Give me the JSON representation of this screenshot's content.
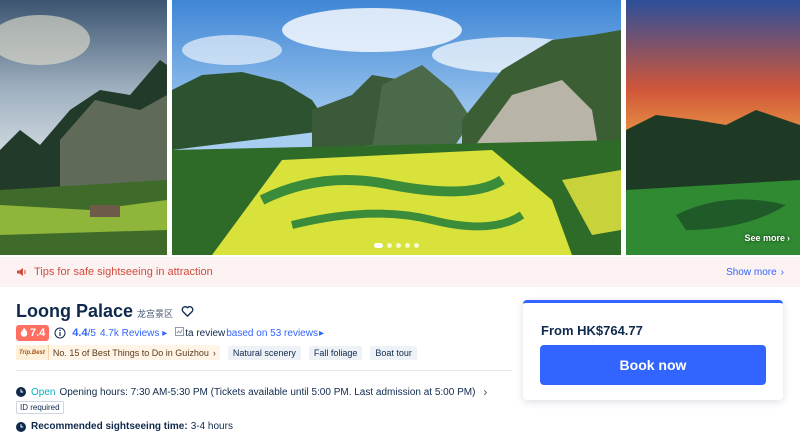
{
  "gallery": {
    "see_more_label": "See more",
    "dot_count": 5,
    "active_dot": 1
  },
  "tips": {
    "text": "Tips for safe sightseeing in attraction",
    "show_more": "Show more"
  },
  "attraction": {
    "name": "Loong Palace",
    "name_local": "龙宫景区",
    "hot_score": "7.4",
    "rating": "4.4",
    "rating_max": "/5",
    "reviews_label": "4.7k Reviews",
    "ta_alt": "ta review",
    "ta_based": "based on 53 reviews",
    "tripbest_logo": "Trip.Best",
    "ranking": "No. 15 of Best Things to Do in Guizhou",
    "tags": [
      "Natural scenery",
      "Fall foliage",
      "Boat tour"
    ],
    "open_status": "Open",
    "opening_hours": "Opening hours: 7:30 AM-5:30 PM (Tickets available until 5:00 PM. Last admission at 5:00 PM)",
    "id_required": "ID required",
    "recommended_label": "Recommended sightseeing time:",
    "recommended_value": "3-4 hours"
  },
  "booking": {
    "price": "From HK$764.77",
    "book_label": "Book now"
  },
  "colors": {
    "accent": "#3264ff",
    "hot": "#ff6f61",
    "tips_text": "#d24c3f",
    "open": "#06aebd"
  }
}
